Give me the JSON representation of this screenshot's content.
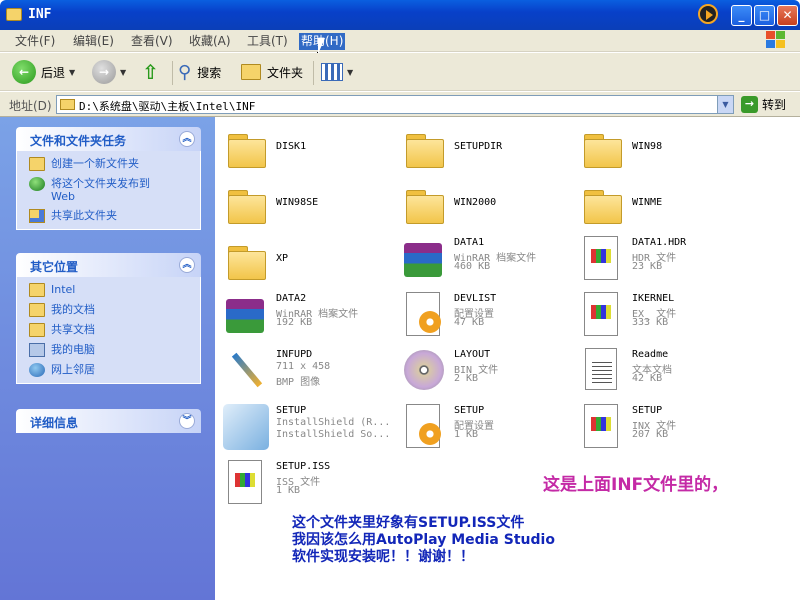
{
  "window": {
    "title": "INF",
    "controls": {
      "minimize": "_",
      "maximize": "□",
      "close": "✕"
    }
  },
  "menu": [
    {
      "label": "文件(F)",
      "active": false
    },
    {
      "label": "编辑(E)",
      "active": false
    },
    {
      "label": "查看(V)",
      "active": false
    },
    {
      "label": "收藏(A)",
      "active": false
    },
    {
      "label": "工具(T)",
      "active": false
    },
    {
      "label": "帮助(H)",
      "active": true
    }
  ],
  "toolbar": {
    "back": "后退",
    "search": "搜索",
    "folders": "文件夹"
  },
  "address": {
    "label": "地址(D)",
    "value": "D:\\系统盘\\驱动\\主板\\Intel\\INF",
    "go": "转到"
  },
  "left_pane": {
    "tasks": {
      "title": "文件和文件夹任务",
      "items": [
        "创建一个新文件夹",
        "将这个文件夹发布到 Web",
        "共享此文件夹"
      ]
    },
    "places": {
      "title": "其它位置",
      "items": [
        "Intel",
        "我的文档",
        "共享文档",
        "我的电脑",
        "网上邻居"
      ]
    },
    "details": {
      "title": "详细信息"
    }
  },
  "files": [
    {
      "name": "DISK1",
      "type": "",
      "size": "",
      "icon": "folder-icon"
    },
    {
      "name": "SETUPDIR",
      "type": "",
      "size": "",
      "icon": "folder-icon"
    },
    {
      "name": "WIN98",
      "type": "",
      "size": "",
      "icon": "folder-icon"
    },
    {
      "name": "WIN98SE",
      "type": "",
      "size": "",
      "icon": "folder-icon"
    },
    {
      "name": "WIN2000",
      "type": "",
      "size": "",
      "icon": "folder-icon"
    },
    {
      "name": "WINME",
      "type": "",
      "size": "",
      "icon": "folder-icon"
    },
    {
      "name": "XP",
      "type": "",
      "size": "",
      "icon": "folder-icon"
    },
    {
      "name": "DATA1",
      "type": "WinRAR 档案文件",
      "size": "460 KB",
      "icon": "winrar-archive-icon"
    },
    {
      "name": "DATA1.HDR",
      "type": "HDR 文件",
      "size": "23 KB",
      "icon": "generic-file-icon"
    },
    {
      "name": "DATA2",
      "type": "WinRAR 档案文件",
      "size": "192 KB",
      "icon": "winrar-archive-icon"
    },
    {
      "name": "DEVLIST",
      "type": "配置设置",
      "size": "47 KB",
      "icon": "config-settings-icon"
    },
    {
      "name": "IKERNEL",
      "type": "EX_ 文件",
      "size": "333 KB",
      "icon": "generic-file-icon"
    },
    {
      "name": "INFUPD",
      "type": "711 x 458",
      "size": "BMP 图像",
      "icon": "bitmap-image-icon"
    },
    {
      "name": "LAYOUT",
      "type": "BIN 文件",
      "size": "2 KB",
      "icon": "disc-bin-icon"
    },
    {
      "name": "Readme",
      "type": "文本文档",
      "size": "42 KB",
      "icon": "text-document-icon"
    },
    {
      "name": "SETUP",
      "type": "InstallShield (R...",
      "size": "InstallShield So...",
      "icon": "installshield-icon"
    },
    {
      "name": "SETUP",
      "type": "配置设置",
      "size": "1 KB",
      "icon": "config-settings-icon"
    },
    {
      "name": "SETUP",
      "type": "INX 文件",
      "size": "207 KB",
      "icon": "generic-file-icon"
    },
    {
      "name": "SETUP.ISS",
      "type": "ISS 文件",
      "size": "1 KB",
      "icon": "generic-file-icon"
    }
  ],
  "annotations": {
    "pink": "这是上面INF文件里的，",
    "blue": [
      "这个文件夹里好象有SETUP.ISS文件",
      "我因该怎么用AutoPlay Media Studio",
      "软件实现安装呢！！谢谢！！"
    ]
  },
  "colors": {
    "title_bar": "#0a4fd8",
    "left_pane": "#7ba2e7",
    "link": "#215dc6",
    "annotation_pink": "#c42aa6",
    "annotation_blue": "#1226b8"
  }
}
